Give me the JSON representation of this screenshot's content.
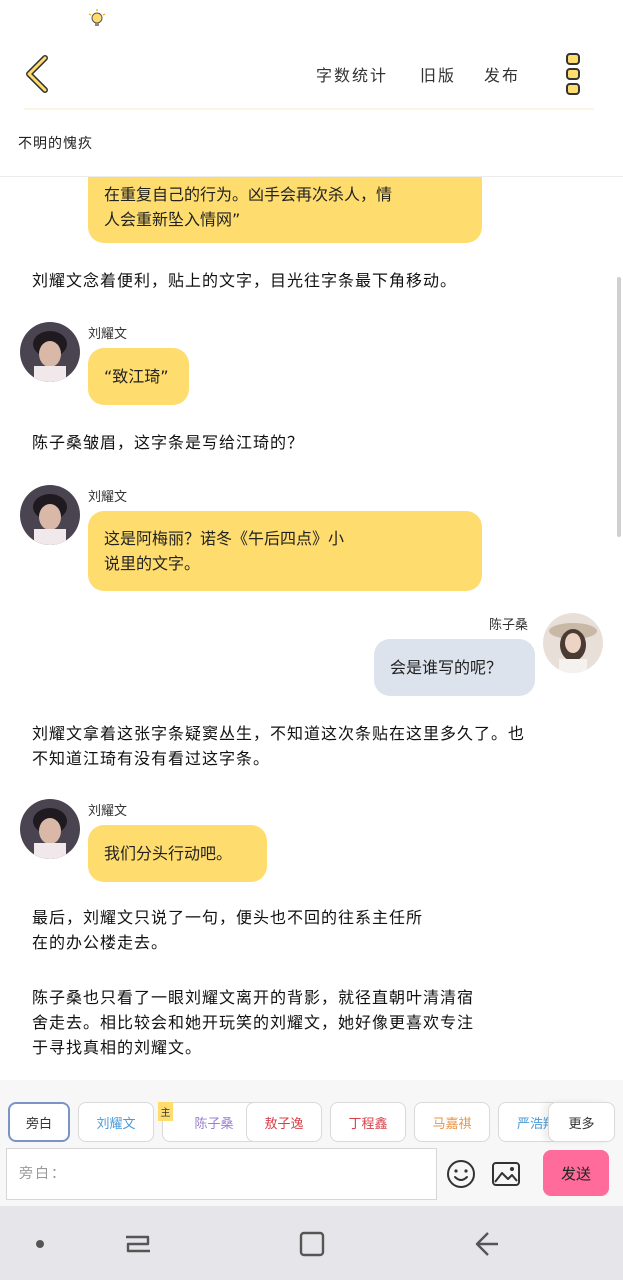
{
  "status_bar": {
    "icon": "lightbulb-icon"
  },
  "header": {
    "back_icon": "chevron-left-icon",
    "word_count": "字数统计",
    "old_version": "旧版",
    "publish": "发布",
    "more_icon": "vertical-dots-icon"
  },
  "story_title": "不明的愧疚",
  "chat": {
    "bubble_top": {
      "line1": "在重复自己的行为。凶手会再次杀人，情",
      "line2": "人会重新坠入情网”"
    },
    "narration1": "刘耀文念着便利，贴上的文字，目光往字条最下角移动。",
    "msg1": {
      "name": "刘耀文",
      "text": "“致江琦”"
    },
    "narration2": "陈子桑皱眉，这字条是写给江琦的？",
    "msg2": {
      "name": "刘耀文",
      "line1": "这是阿梅丽？诺冬《午后四点》小",
      "line2": "说里的文字。"
    },
    "msg3": {
      "name": "陈子桑",
      "text": "会是谁写的呢？"
    },
    "narration3": {
      "line1": "刘耀文拿着这张字条疑窦丛生，不知道这次条贴在这里多久了。也",
      "line2": "不知道江琦有没有看过这字条。"
    },
    "msg4": {
      "name": "刘耀文",
      "text": "我们分头行动吧。"
    },
    "narration4": {
      "line1": "最后，刘耀文只说了一句，便头也不回的往系主任所",
      "line2": "在的办公楼走去。"
    },
    "narration5": {
      "line1": "陈子桑也只看了一眼刘耀文离开的背影，就径直朝叶清清宿",
      "line2": "舍走去。相比较会和她开玩笑的刘耀文，她好像更喜欢专注",
      "line3": "于寻找真相的刘耀文。"
    }
  },
  "characters": {
    "items": [
      {
        "label": "旁白",
        "color": "#333333"
      },
      {
        "label": "刘耀文",
        "color": "#4a9bd8"
      },
      {
        "label": "陈子桑",
        "color": "#9b7fd0"
      },
      {
        "label": "敖子逸",
        "color": "#d8404a"
      },
      {
        "label": "丁程鑫",
        "color": "#d8404a"
      },
      {
        "label": "马嘉祺",
        "color": "#e8954a"
      },
      {
        "label": "严浩翔",
        "color": "#4a9bd8"
      }
    ],
    "main_tag": "主",
    "more": "更多"
  },
  "input": {
    "placeholder": "旁白：",
    "emoji_icon": "smiley-icon",
    "image_icon": "image-icon",
    "send": "发送"
  },
  "nav_bar": {
    "recent_icon": "recent-apps-icon",
    "home_icon": "home-icon",
    "back_icon": "back-arrow-icon"
  }
}
